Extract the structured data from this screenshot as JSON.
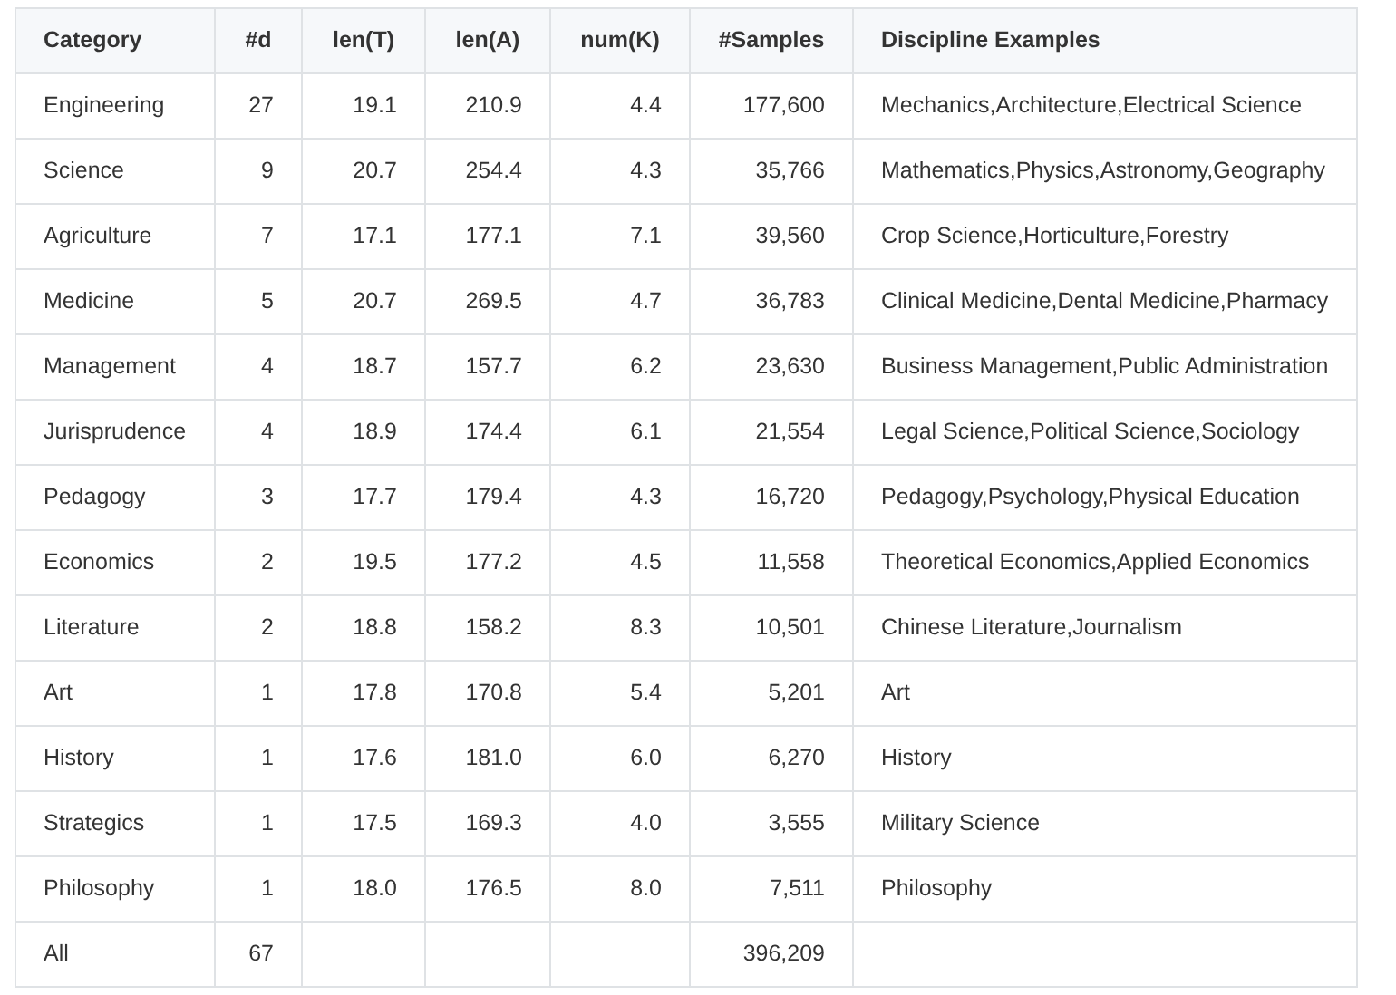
{
  "table": {
    "columns": [
      "Category",
      "#d",
      "len(T)",
      "len(A)",
      "num(K)",
      "#Samples",
      "Discipline Examples"
    ],
    "rows": [
      [
        "Engineering",
        "27",
        "19.1",
        "210.9",
        "4.4",
        "177,600",
        "Mechanics,Architecture,Electrical Science"
      ],
      [
        "Science",
        "9",
        "20.7",
        "254.4",
        "4.3",
        "35,766",
        "Mathematics,Physics,Astronomy,Geography"
      ],
      [
        "Agriculture",
        "7",
        "17.1",
        "177.1",
        "7.1",
        "39,560",
        "Crop Science,Horticulture,Forestry"
      ],
      [
        "Medicine",
        "5",
        "20.7",
        "269.5",
        "4.7",
        "36,783",
        "Clinical Medicine,Dental Medicine,Pharmacy"
      ],
      [
        "Management",
        "4",
        "18.7",
        "157.7",
        "6.2",
        "23,630",
        "Business Management,Public Administration"
      ],
      [
        "Jurisprudence",
        "4",
        "18.9",
        "174.4",
        "6.1",
        "21,554",
        "Legal Science,Political Science,Sociology"
      ],
      [
        "Pedagogy",
        "3",
        "17.7",
        "179.4",
        "4.3",
        "16,720",
        "Pedagogy,Psychology,Physical Education"
      ],
      [
        "Economics",
        "2",
        "19.5",
        "177.2",
        "4.5",
        "11,558",
        "Theoretical Economics,Applied Economics"
      ],
      [
        "Literature",
        "2",
        "18.8",
        "158.2",
        "8.3",
        "10,501",
        "Chinese Literature,Journalism"
      ],
      [
        "Art",
        "1",
        "17.8",
        "170.8",
        "5.4",
        "5,201",
        "Art"
      ],
      [
        "History",
        "1",
        "17.6",
        "181.0",
        "6.0",
        "6,270",
        "History"
      ],
      [
        "Strategics",
        "1",
        "17.5",
        "169.3",
        "4.0",
        "3,555",
        "Military Science"
      ],
      [
        "Philosophy",
        "1",
        "18.0",
        "176.5",
        "8.0",
        "7,511",
        "Philosophy"
      ],
      [
        "All",
        "67",
        "",
        "",
        "",
        "396,209",
        ""
      ]
    ]
  }
}
